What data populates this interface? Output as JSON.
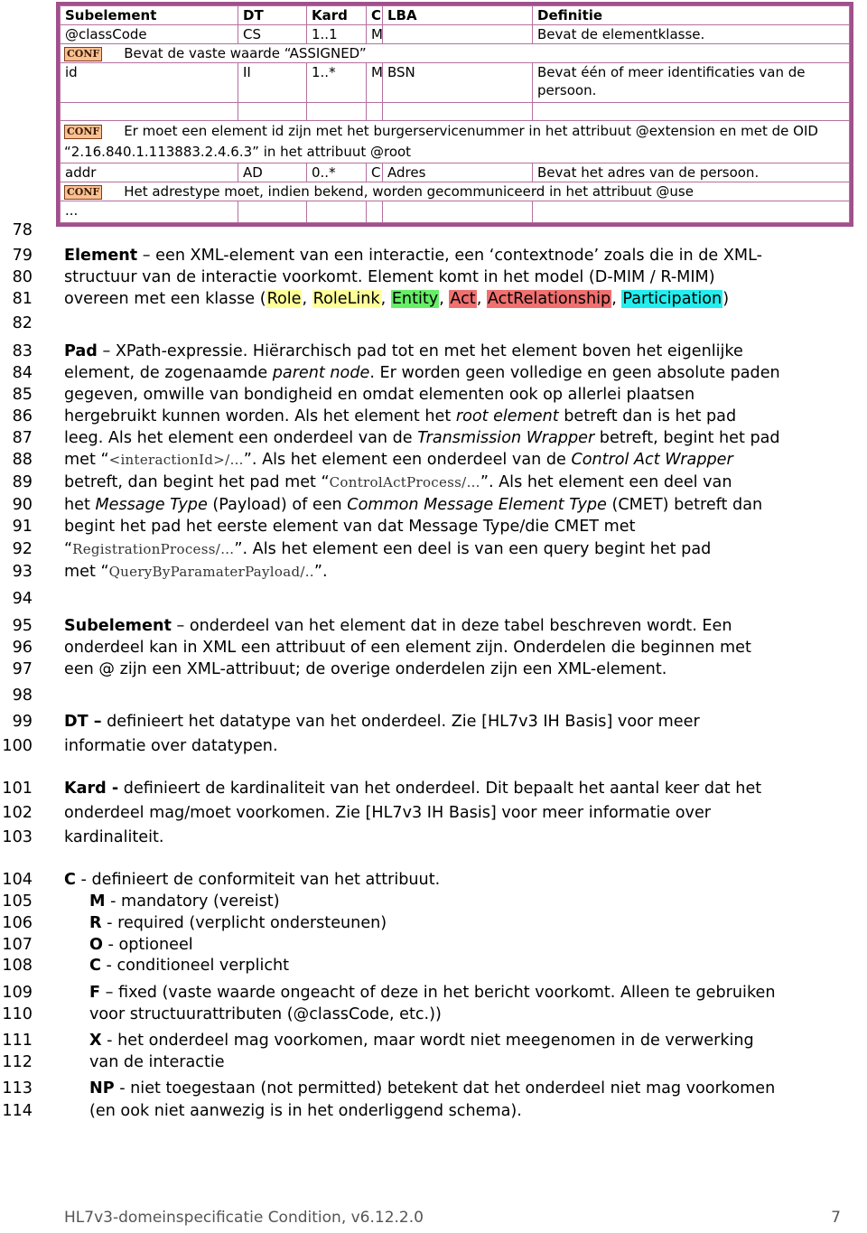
{
  "table": {
    "headers": [
      "Subelement",
      "DT",
      "Kard",
      "C",
      "LBA",
      "Definitie"
    ],
    "conf_badge": "CONF",
    "rows": [
      {
        "subelement": "@classCode",
        "dt": "CS",
        "kard": "1..1",
        "c": "M",
        "lba": "",
        "definitie": "Bevat de elementklasse."
      },
      {
        "conf": "Bevat de vaste waarde “ASSIGNED”"
      },
      {
        "subelement": "id",
        "dt": "II",
        "kard": "1..*",
        "c": "M",
        "lba": "BSN",
        "definitie": "Bevat één of meer identificaties van de persoon."
      },
      {
        "conf": "Er moet een element id zijn met het burgerservicenummer in het attribuut @extension en met de OID “2.16.840.1.113883.2.4.6.3” in het attribuut @root"
      },
      {
        "subelement": "addr",
        "dt": "AD",
        "kard": "0..*",
        "c": "C",
        "lba": "Adres",
        "definitie": "Bevat het adres van de persoon."
      },
      {
        "conf": "Het adrestype moet, indien bekend, worden gecommuniceerd in het attribuut @use"
      },
      {
        "subelement": "...",
        "dt": "",
        "kard": "",
        "c": "",
        "lba": "",
        "definitie": ""
      }
    ]
  },
  "highlight_colors": {
    "role": "#ffff99",
    "entity": "#66ee66",
    "act": "#f07070",
    "participation": "#22eeee"
  },
  "lines": {
    "l78": "78",
    "l79": {
      "n": "79",
      "term": "Element",
      "rest": " – een XML-element van een interactie, een ‘contextnode’ zoals die in de XML-"
    },
    "l80": {
      "n": "80",
      "text": "structuur van de interactie voorkomt. Element komt in het model (D-MIM / R-MIM)"
    },
    "l81": {
      "n": "81",
      "pre": "overeen met een klasse (",
      "role": "Role",
      "rolelink": "RoleLink",
      "entity": "Entity",
      "act": "Act",
      "actrel": "ActRelationship",
      "participation": "Participation",
      "sep": ", ",
      "post": ")"
    },
    "l82": "82",
    "l83": {
      "n": "83",
      "term": "Pad",
      "rest": " – XPath-expressie. Hiërarchisch pad tot en met het element boven het eigenlijke"
    },
    "l84": {
      "n": "84",
      "a": "element, de zogenaamde ",
      "i": "parent node",
      "b": ". Er worden geen volledige en geen absolute paden"
    },
    "l85": {
      "n": "85",
      "text": "gegeven, omwille van bondigheid en omdat elementen ook op allerlei plaatsen"
    },
    "l86": {
      "n": "86",
      "a": "hergebruikt kunnen worden. Als het element het ",
      "i": "root element",
      "b": " betreft dan is het pad"
    },
    "l87": {
      "n": "87",
      "a": "leeg. Als het element een onderdeel van de ",
      "i": "Transmission Wrapper",
      "b": " betreft, begint het pad"
    },
    "l88": {
      "n": "88",
      "a": "met “",
      "code": "<interactionId>/…",
      "b": "”. Als het element een onderdeel van de ",
      "i": "Control Act Wrapper"
    },
    "l89": {
      "n": "89",
      "a": "betreft, dan begint het pad met “",
      "code": "ControlActProcess/…",
      "b": "”. Als het element een deel van"
    },
    "l90": {
      "n": "90",
      "a": "het ",
      "i1": "Message Type",
      "b": " (Payload) of een ",
      "i2": "Common Message Element Type",
      "c": " (CMET) betreft dan"
    },
    "l91": {
      "n": "91",
      "text": "begint het pad het eerste element van dat Message Type/die CMET met"
    },
    "l92": {
      "n": "92",
      "a": "“",
      "code": "RegistrationProcess/…",
      "b": "”. Als het element een deel is van een query begint het pad"
    },
    "l93": {
      "n": "93",
      "a": "met “",
      "code": "QueryByParamaterPayload/..",
      "b": "”."
    },
    "l94": "94",
    "l95": {
      "n": "95",
      "term": "Subelement",
      "rest": " – onderdeel van het element dat in deze tabel beschreven wordt. Een"
    },
    "l96": {
      "n": "96",
      "text": "onderdeel kan in XML een attribuut of een element zijn. Onderdelen die beginnen met"
    },
    "l97": {
      "n": "97",
      "text": "een @ zijn een XML-attribuut; de overige onderdelen zijn een XML-element."
    },
    "l98": "98",
    "l99": {
      "n": "99",
      "term": "DT –",
      "rest": " definieert het datatype van het onderdeel. Zie [HL7v3 IH Basis] voor meer"
    },
    "l100": {
      "n": "100",
      "text": "informatie over datatypen."
    },
    "l101": {
      "n": "101",
      "term": "Kard -",
      "rest": " definieert de kardinaliteit van het onderdeel. Dit bepaalt het aantal keer dat het"
    },
    "l102": {
      "n": "102",
      "text": "onderdeel mag/moet voorkomen. Zie [HL7v3 IH Basis] voor meer informatie over"
    },
    "l103": {
      "n": "103",
      "text": "kardinaliteit."
    },
    "l104": {
      "n": "104",
      "term": "C",
      "rest": " - definieert de conformiteit van het attribuut."
    },
    "l105": {
      "n": "105",
      "term": "M",
      "rest": " - mandatory (vereist)"
    },
    "l106": {
      "n": "106",
      "term": "R",
      "rest": " - required (verplicht ondersteunen)"
    },
    "l107": {
      "n": "107",
      "term": "O",
      "rest": " - optioneel"
    },
    "l108": {
      "n": "108",
      "term": "C",
      "rest": " - conditioneel verplicht"
    },
    "l109": {
      "n": "109",
      "term": "F",
      "rest": " – fixed (vaste waarde ongeacht of deze in het bericht voorkomt. Alleen te gebruiken"
    },
    "l110": {
      "n": "110",
      "text": "voor structuurattributen (@classCode, etc.))"
    },
    "l111": {
      "n": "111",
      "term": "X",
      "rest": " - het onderdeel mag voorkomen, maar wordt niet meegenomen in de verwerking"
    },
    "l112": {
      "n": "112",
      "text": "van de interactie"
    },
    "l113": {
      "n": "113",
      "term": "NP",
      "rest": " - niet toegestaan (not permitted) betekent dat het onderdeel niet mag voorkomen"
    },
    "l114": {
      "n": "114",
      "text": "(en ook niet aanwezig is in het onderliggend schema)."
    }
  },
  "footer": {
    "title": "HL7v3-domeinspecificatie Condition, v6.12.2.0",
    "page": "7"
  }
}
